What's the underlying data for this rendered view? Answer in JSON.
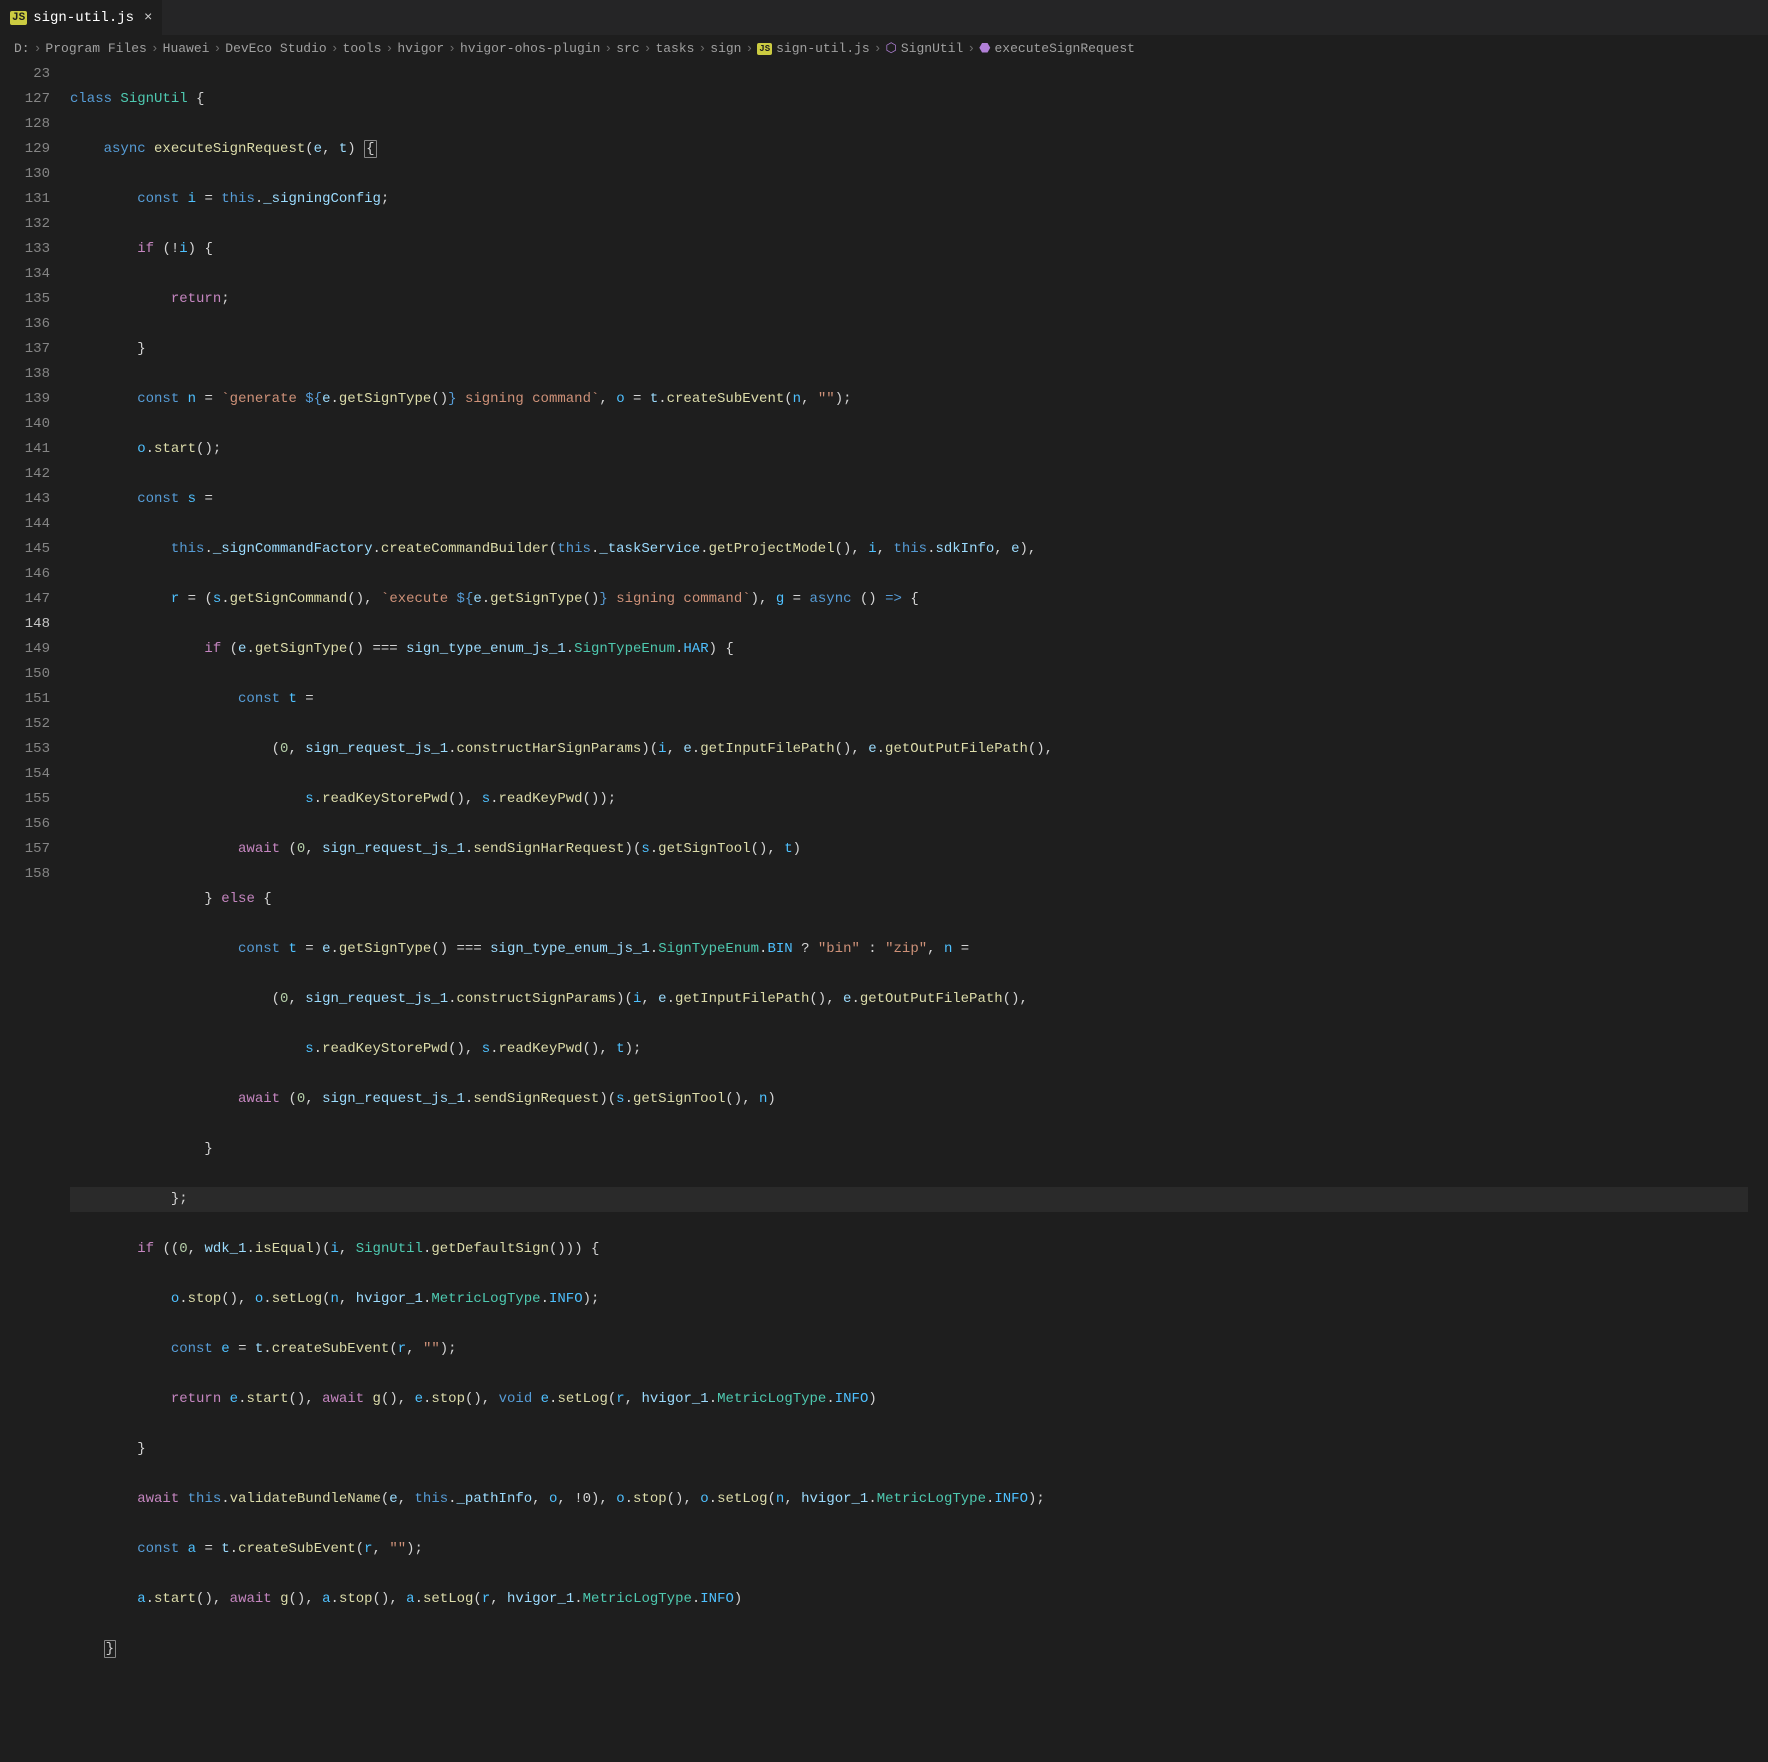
{
  "tab": {
    "icon_label": "JS",
    "title": "sign-util.js",
    "close": "×"
  },
  "breadcrumb": {
    "parts": [
      "D:",
      "Program Files",
      "Huawei",
      "DevEco Studio",
      "tools",
      "hvigor",
      "hvigor-ohos-plugin",
      "src",
      "tasks",
      "sign"
    ],
    "file_icon": "JS",
    "file": "sign-util.js",
    "class_sym": "SignUtil",
    "method_sym": "executeSignRequest",
    "sep": "›"
  },
  "lines": {
    "l23": "23",
    "l127": "127",
    "l128": "128",
    "l129": "129",
    "l130": "130",
    "l131": "131",
    "l132": "132",
    "l133": "133",
    "l134": "134",
    "l135": "135",
    "l136": "136",
    "l137": "137",
    "l138": "138",
    "l139": "139",
    "l140": "140",
    "l141": "141",
    "l142": "142",
    "l143": "143",
    "l144": "144",
    "l145": "145",
    "l146": "146",
    "l147": "147",
    "l148": "148",
    "l149": "149",
    "l150": "150",
    "l151": "151",
    "l152": "152",
    "l153": "153",
    "l154": "154",
    "l155": "155",
    "l156": "156",
    "l157": "157",
    "l158": "158"
  },
  "code": {
    "class": "class",
    "SignUtil": "SignUtil",
    "async": "async",
    "executeSignRequest": "executeSignRequest",
    "e": "e",
    "t": "t",
    "const": "const",
    "i": "i",
    "this": "this",
    "_signingConfig": "_signingConfig",
    "if": "if",
    "return": "return",
    "n": "n",
    "generate": "`generate ",
    "sig_cmd": " signing command`",
    "getSignType": "getSignType",
    "o": "o",
    "createSubEvent": "createSubEvent",
    "empty": "\"\"",
    "start": "start",
    "s": "s",
    "_signCommandFactory": "_signCommandFactory",
    "createCommandBuilder": "createCommandBuilder",
    "_taskService": "_taskService",
    "getProjectModel": "getProjectModel",
    "sdkInfo": "sdkInfo",
    "r": "r",
    "getSignCommand": "getSignCommand",
    "execute": "`execute ",
    "g": "g",
    "sign_type_enum_js_1": "sign_type_enum_js_1",
    "SignTypeEnum": "SignTypeEnum",
    "HAR": "HAR",
    "zero": "0",
    "sign_request_js_1": "sign_request_js_1",
    "constructHarSignParams": "constructHarSignParams",
    "getInputFilePath": "getInputFilePath",
    "getOutPutFilePath": "getOutPutFilePath",
    "readKeyStorePwd": "readKeyStorePwd",
    "readKeyPwd": "readKeyPwd",
    "await": "await",
    "sendSignHarRequest": "sendSignHarRequest",
    "getSignTool": "getSignTool",
    "else": "else",
    "BIN": "BIN",
    "bin": "\"bin\"",
    "zip": "\"zip\"",
    "constructSignParams": "constructSignParams",
    "sendSignRequest": "sendSignRequest",
    "wdk_1": "wdk_1",
    "isEqual": "isEqual",
    "getDefaultSign": "getDefaultSign",
    "stop": "stop",
    "setLog": "setLog",
    "hvigor_1": "hvigor_1",
    "MetricLogType": "MetricLogType",
    "INFO": "INFO",
    "void": "void",
    "validateBundleName": "validateBundleName",
    "_pathInfo": "_pathInfo",
    "not0": "!0",
    "a": "a"
  }
}
